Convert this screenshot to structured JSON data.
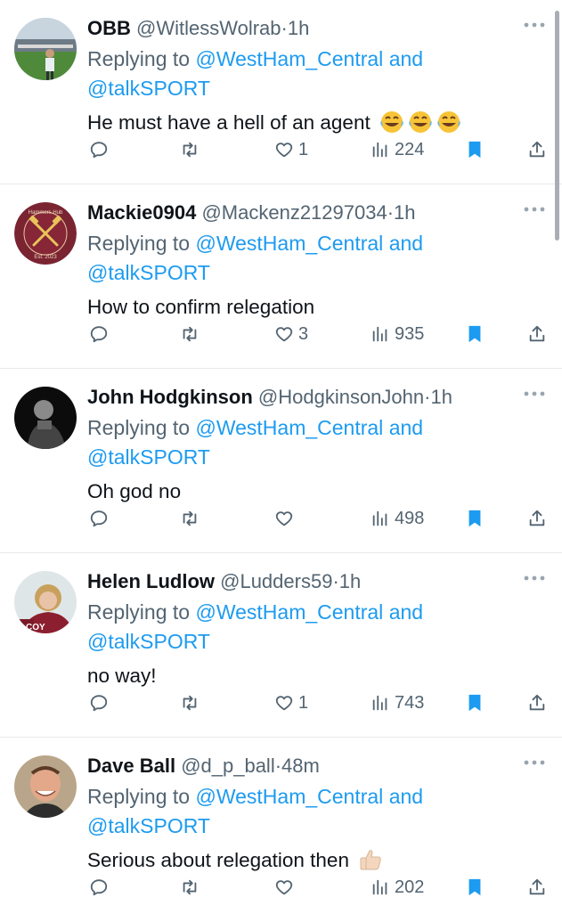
{
  "colors": {
    "link": "#1d9bf0",
    "muted": "#536471",
    "bookmark": "#1d9bf0",
    "text": "#0f1419"
  },
  "tweets": [
    {
      "name": "OBB",
      "handle": "@WitlessWolrab",
      "time": "1h",
      "replying_prefix": "Replying to",
      "reply_to_1": "@WestHam_Central",
      "and": "and",
      "reply_to_2": "@talkSPORT",
      "text": "He must have a hell of an agent",
      "emoji": [
        "face-with-tears-of-joy",
        "face-with-tears-of-joy",
        "face-with-tears-of-joy"
      ],
      "likes": "1",
      "views": "224",
      "avatar": "stadium-photo"
    },
    {
      "name": "Mackie0904",
      "handle": "@Mackenz21297034",
      "time": "1h",
      "replying_prefix": "Replying to",
      "reply_to_1": "@WestHam_Central",
      "and": "and",
      "reply_to_2": "@talkSPORT",
      "text": "How to confirm relegation",
      "emoji": [],
      "likes": "3",
      "views": "935",
      "avatar": "hammers-hub-badge",
      "avatar_text_top": "Hammers Hub",
      "avatar_text_bottom": "Est. 2023"
    },
    {
      "name": "John Hodgkinson",
      "handle": "@HodgkinsonJohn",
      "time": "1h",
      "replying_prefix": "Replying to",
      "reply_to_1": "@WestHam_Central",
      "and": "and",
      "reply_to_2": "@talkSPORT",
      "text": "Oh god no",
      "emoji": [],
      "likes": "",
      "views": "498",
      "avatar": "person-dark-photo"
    },
    {
      "name": "Helen Ludlow",
      "handle": "@Ludders59",
      "time": "1h",
      "replying_prefix": "Replying to",
      "reply_to_1": "@WestHam_Central",
      "and": "and",
      "reply_to_2": "@talkSPORT",
      "text": "no way!",
      "emoji": [],
      "likes": "1",
      "views": "743",
      "avatar": "person-claret-photo",
      "avatar_text": "COY"
    },
    {
      "name": "Dave Ball",
      "handle": "@d_p_ball",
      "time": "48m",
      "replying_prefix": "Replying to",
      "reply_to_1": "@WestHam_Central",
      "and": "and",
      "reply_to_2": "@talkSPORT",
      "text": "Serious about relegation then",
      "emoji": [
        "thumbs-up-light-skin"
      ],
      "likes": "",
      "views": "202",
      "avatar": "smiling-man-photo"
    }
  ],
  "separator": "·"
}
